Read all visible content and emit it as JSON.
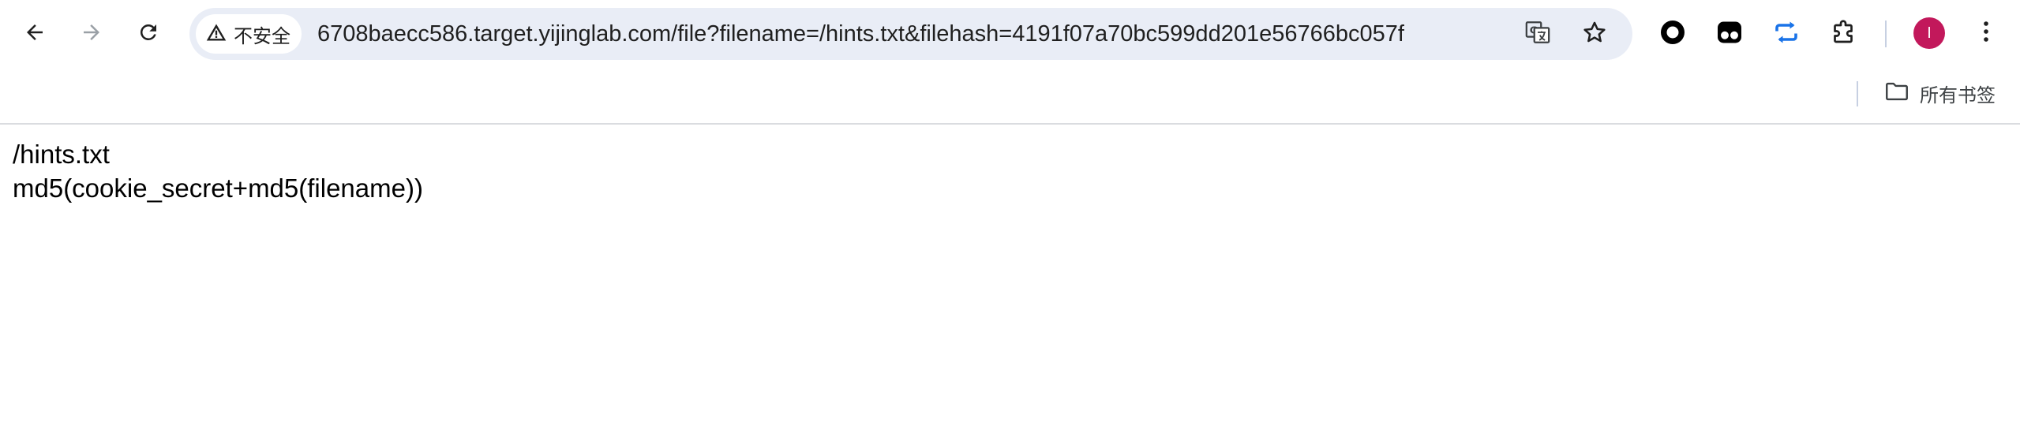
{
  "browser": {
    "nav": {
      "back_icon": "arrow-left-icon",
      "forward_icon": "arrow-right-icon",
      "reload_icon": "reload-icon"
    },
    "omnibox": {
      "security_label": "不安全",
      "security_icon": "warning-triangle-icon",
      "url": "6708baecc586.target.yijinglab.com/file?filename=/hints.txt&filehash=4191f07a70bc599dd201e56766bc057f",
      "translate_icon": "translate-icon",
      "bookmark_icon": "star-icon"
    },
    "extensions": [
      "record-icon",
      "extension-dark-icon",
      "sync-icon",
      "puzzle-icon"
    ],
    "profile_initial": "I",
    "menu_icon": "three-dots-icon",
    "colors": {
      "omnibox_bg": "#e9edf6",
      "avatar_bg": "#c2185b",
      "sync_accent": "#1a73e8"
    }
  },
  "bookmarks_bar": {
    "all_bookmarks_label": "所有书签",
    "folder_icon": "folder-icon"
  },
  "page": {
    "lines": [
      "/hints.txt",
      "md5(cookie_secret+md5(filename))"
    ]
  }
}
